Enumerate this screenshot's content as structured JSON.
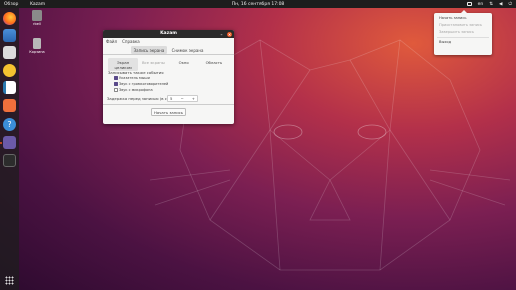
{
  "topbar": {
    "activities": "Обзор",
    "app": "Kazam",
    "clock": "Пн, 16 сентября 17:08",
    "lang": "en",
    "tray_icons": [
      "kazam-tray-icon",
      "language-indicator",
      "network-icon",
      "volume-icon",
      "power-icon"
    ]
  },
  "dock": {
    "items": [
      "firefox-icon",
      "mail-icon",
      "files-icon",
      "music-icon",
      "writer-icon",
      "software-icon",
      "help-icon",
      "kazam-icon",
      "terminal-icon"
    ]
  },
  "desktop": {
    "icons": [
      {
        "label": "rbell",
        "icon": "home-folder-icon"
      },
      {
        "label": "Корзина",
        "icon": "trash-icon"
      }
    ]
  },
  "window": {
    "title": "Kazam",
    "menu": [
      "Файл",
      "Справка"
    ],
    "tabs": [
      "Запись экрана",
      "Снимок экрана"
    ],
    "modes": [
      "Экран целиком",
      "Все экраны",
      "Окно",
      "Область"
    ],
    "options_heading": "Записывать также события",
    "options": [
      {
        "label": "Указатель мыши",
        "checked": true
      },
      {
        "label": "Звук с громкоговорителей",
        "checked": true
      },
      {
        "label": "Звук с микрофона",
        "checked": false
      }
    ],
    "delay_label": "Задержка перед записью (в с.):",
    "delay_value": "5",
    "delay_minus": "−",
    "delay_plus": "+",
    "start_button": "Начать запись"
  },
  "tray_menu": {
    "items": [
      {
        "label": "Начать запись",
        "enabled": true
      },
      {
        "label": "Приостановить запись",
        "enabled": false
      },
      {
        "label": "Завершить запись",
        "enabled": false
      },
      {
        "label": "Выход",
        "enabled": true
      }
    ]
  },
  "colors": {
    "accent": "#e95420",
    "topbar": "#1d1d1d",
    "check": "#5a4a8a"
  }
}
